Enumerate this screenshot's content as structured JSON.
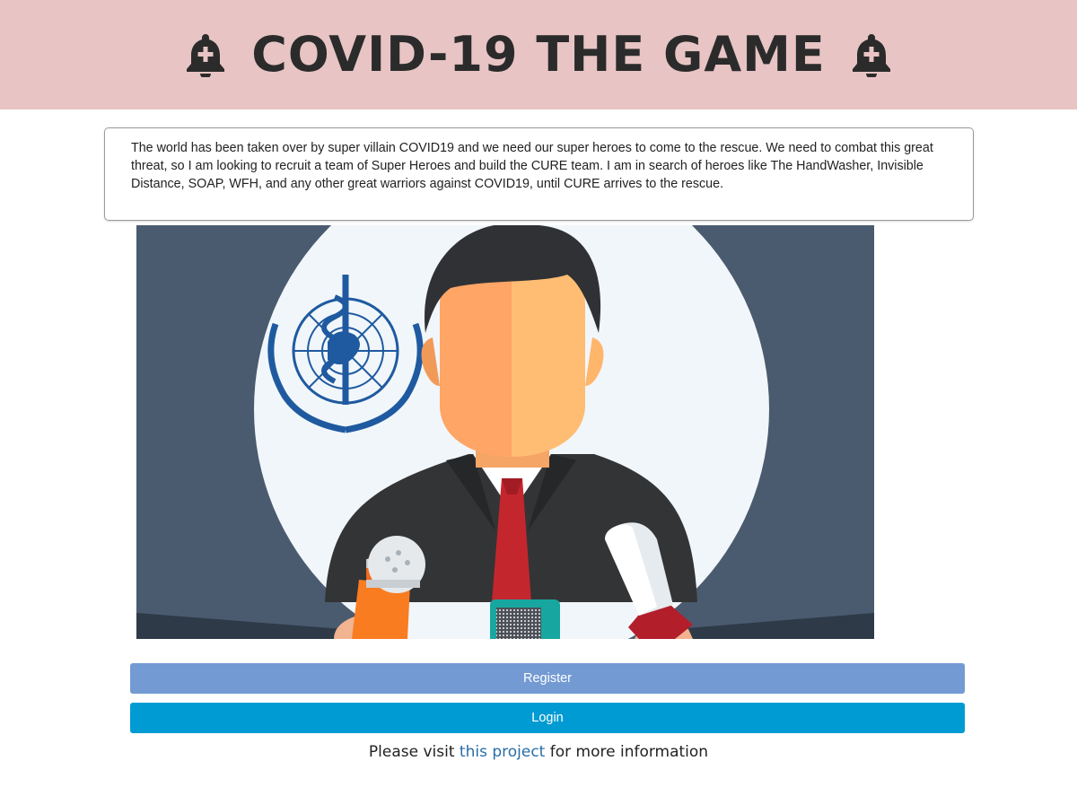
{
  "header": {
    "title": "COVID-19 THE GAME",
    "left_icon": "bell-plus-icon",
    "right_icon": "bell-plus-icon"
  },
  "intro": {
    "text": "The world has been taken over by super villain COVID19 and we need our super heroes to come to the rescue. We need to combat this great threat, so I am looking to recruit a team of Super Heroes and build the CURE team. I am in search of heroes like The HandWasher, Invisible Distance, SOAP, WFH, and any other great warriors against COVID19, until CURE arrives to the rescue."
  },
  "hero_image": {
    "subject": "spokesperson-with-microphones",
    "emblem": "who-emblem"
  },
  "actions": {
    "register_label": "Register",
    "login_label": "Login"
  },
  "footer": {
    "prefix": "Please visit ",
    "link_text": "this project",
    "suffix": " for more information"
  },
  "colors": {
    "header_bg": "#e8c4c4",
    "register_bg": "#739ad3",
    "login_bg": "#009bd2",
    "link": "#286da6",
    "hero_bg": "#4a5b6f"
  }
}
